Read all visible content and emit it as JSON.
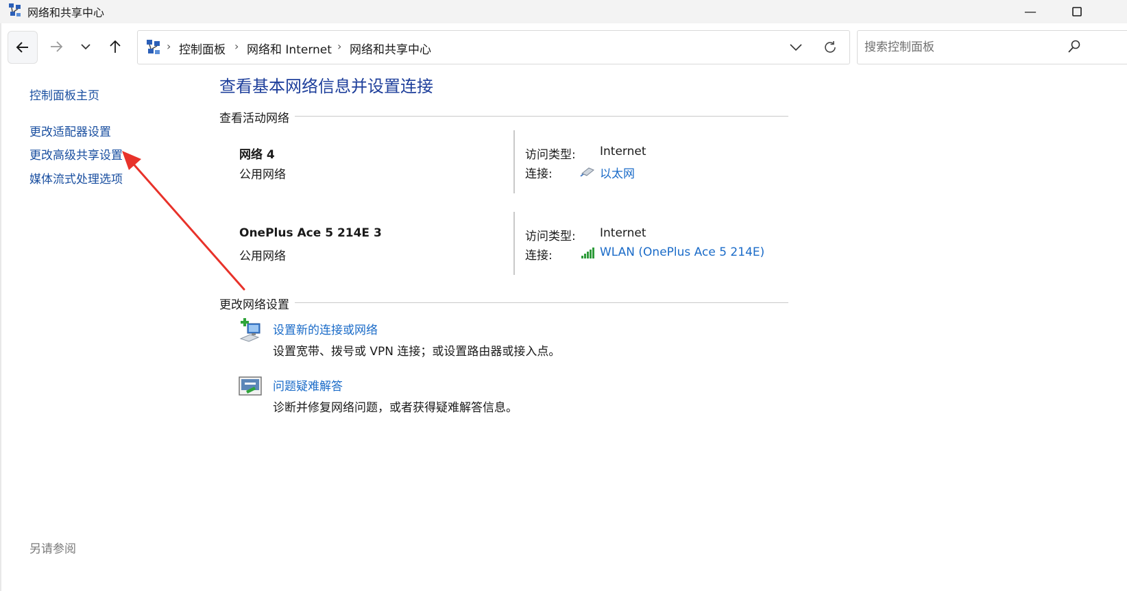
{
  "window": {
    "title": "网络和共享中心",
    "minimize_glyph": "—",
    "maximize_glyph": "☐"
  },
  "address_bar": {
    "crumbs": [
      "控制面板",
      "网络和 Internet",
      "网络和共享中心"
    ],
    "separator": "›"
  },
  "search": {
    "placeholder": "搜索控制面板"
  },
  "sidebar": {
    "home": "控制面板主页",
    "items": [
      "更改适配器设置",
      "更改高级共享设置",
      "媒体流式处理选项"
    ],
    "see_also": "另请参阅"
  },
  "main": {
    "title": "查看基本网络信息并设置连接",
    "active_networks_heading": "查看活动网络",
    "networks": [
      {
        "name": "网络 4",
        "category": "公用网络",
        "access_label": "访问类型:",
        "access_value": "Internet",
        "connection_label": "连接:",
        "connection_value": "以太网",
        "connection_icon": "ethernet-icon"
      },
      {
        "name": "OnePlus Ace 5 214E 3",
        "category": "公用网络",
        "access_label": "访问类型:",
        "access_value": "Internet",
        "connection_label": "连接:",
        "connection_value": "WLAN (OnePlus Ace 5 214E)",
        "connection_icon": "wifi-signal-icon"
      }
    ],
    "change_settings_heading": "更改网络设置",
    "tasks": [
      {
        "link": "设置新的连接或网络",
        "description": "设置宽带、拨号或 VPN 连接；或设置路由器或接入点。",
        "icon": "new-connection-icon"
      },
      {
        "link": "问题疑难解答",
        "description": "诊断并修复网络问题，或者获得疑难解答信息。",
        "icon": "troubleshoot-icon"
      }
    ]
  },
  "colors": {
    "link": "#1a6bc8",
    "nav_link": "#1a4fa0",
    "title": "#1e3f9b",
    "annotation_arrow": "#e8322a"
  }
}
